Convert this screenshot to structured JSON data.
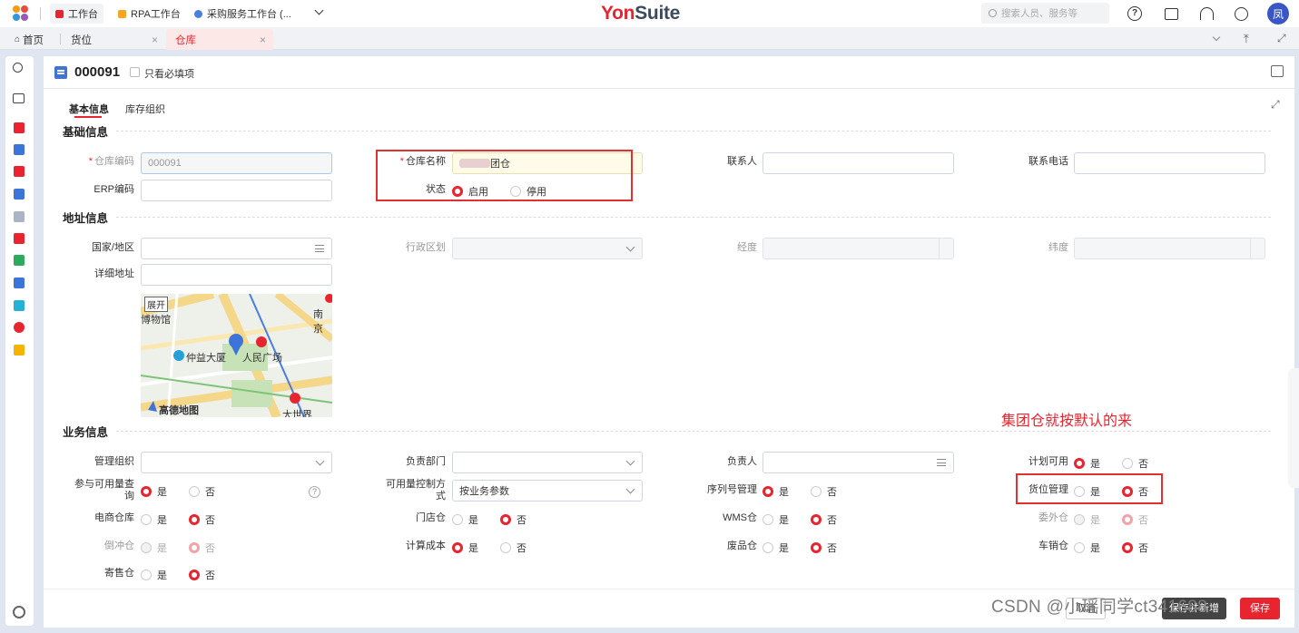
{
  "topbar": {
    "tabs": [
      {
        "label": "工作台"
      },
      {
        "label": "RPA工作台"
      },
      {
        "label": "采购服务工作台 (..."
      }
    ],
    "brand_prefix": "Yon",
    "brand_suffix": "Suite",
    "search_placeholder": "搜索人员、服务等",
    "avatar": "凤"
  },
  "pagetabs": [
    {
      "label": "首页"
    },
    {
      "label": "货位"
    },
    {
      "label": "仓库"
    }
  ],
  "form": {
    "code": "000091",
    "required_only_label": "只看必填项",
    "tabs": [
      "基本信息",
      "库存组织"
    ],
    "sections": {
      "basic": "基础信息",
      "address": "地址信息",
      "business": "业务信息"
    },
    "basic": {
      "code_label": "仓库编码",
      "code_value": "000091",
      "name_label": "仓库名称",
      "name_value": "团仓",
      "contact_label": "联系人",
      "phone_label": "联系电话",
      "erp_label": "ERP编码",
      "status_label": "状态",
      "status_on": "启用",
      "status_off": "停用"
    },
    "address": {
      "country_label": "国家/地区",
      "region_label": "行政区划",
      "lng_label": "经度",
      "lat_label": "纬度",
      "detail_label": "详细地址"
    },
    "map": {
      "expand": "展开",
      "museum": "博物馆",
      "nanjing": "南京",
      "zhongyi": "仲益大厦",
      "square": "人民广场",
      "amap": "高德地图",
      "world": "大世界"
    },
    "business": {
      "org_label": "管理组织",
      "dept_label": "负责部门",
      "person_label": "负责人",
      "plan_label": "计划可用",
      "avail_label": "参与可用量查询",
      "ctrl_label": "可用量控制方式",
      "ctrl_value": "按业务参数",
      "serial_label": "序列号管理",
      "location_label": "货位管理",
      "ecom_label": "电商仓库",
      "store_label": "门店仓",
      "wms_label": "WMS仓",
      "outsource_label": "委外仓",
      "flush_label": "倒冲仓",
      "cost_label": "计算成本",
      "waste_label": "废品仓",
      "carsale_label": "车销仓",
      "consign_label": "寄售仓",
      "yes": "是",
      "no": "否"
    },
    "annotation": "集团仓就按默认的来"
  },
  "footer": {
    "btn1": "取消",
    "btn2": "保存并新增",
    "btn3": "保存"
  },
  "watermark": "CSDN @小瑶同学ct341688",
  "colors": {
    "accent": "#e8242e",
    "brand_blue": "#3d74d8",
    "annotation_box": "#e03030"
  }
}
